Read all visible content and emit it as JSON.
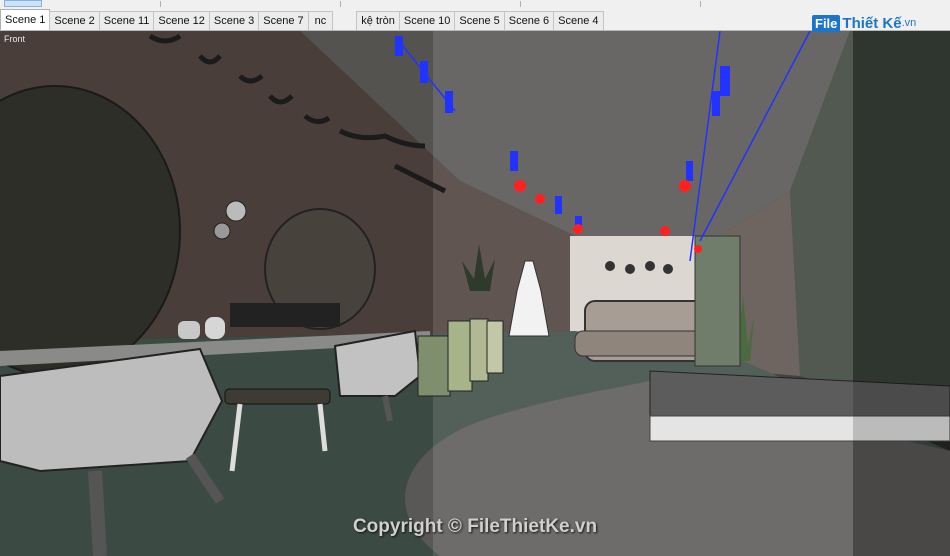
{
  "tabs": [
    {
      "label": "Scene 1",
      "active": true
    },
    {
      "label": "Scene 2"
    },
    {
      "label": "Scene 11"
    },
    {
      "label": "Scene 12"
    },
    {
      "label": "Scene 3"
    },
    {
      "label": "Scene 7"
    },
    {
      "label": "nc"
    },
    {
      "label": "kệ tròn"
    },
    {
      "label": "Scene 10"
    },
    {
      "label": "Scene 5"
    },
    {
      "label": "Scene 6"
    },
    {
      "label": "Scene 4"
    }
  ],
  "viewport": {
    "camera_label": "Front"
  },
  "logo": {
    "box_text": "File",
    "name_text": "Thiết Kế",
    "suffix_text": ".vn"
  },
  "watermark": {
    "text": "Copyright © FileThietKe.vn"
  },
  "colors": {
    "accent": "#1c75c9",
    "light_blue": "#2233ff",
    "light_red": "#ff2020"
  },
  "icons": [
    "select-arrow-icon"
  ]
}
